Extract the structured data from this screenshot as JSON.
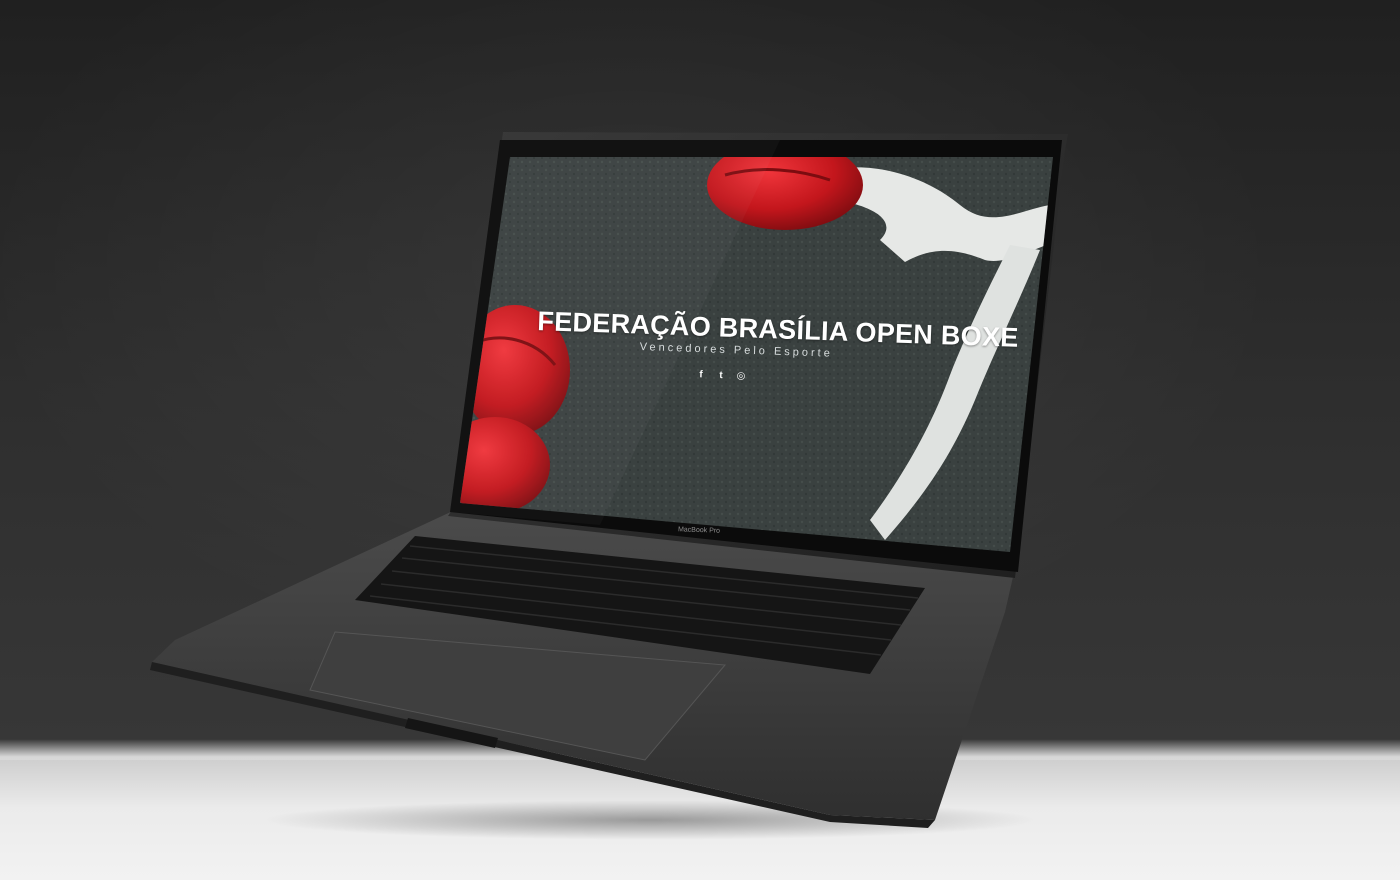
{
  "website": {
    "title": "FEDERAÇÃO BRASÍLIA OPEN BOXE",
    "tagline": "Vencedores Pelo Esporte",
    "social_icons": [
      {
        "icon": "facebook-icon",
        "glyph": "f"
      },
      {
        "icon": "twitter-icon",
        "glyph": "t"
      },
      {
        "icon": "instagram-icon",
        "glyph": "◎"
      }
    ]
  },
  "laptop": {
    "bezel_label": "MacBook Pro"
  },
  "colors": {
    "background": "#2b2b2b",
    "screen_mat": "#434b49",
    "glove_red": "#c3161c",
    "wrap_white": "#e6e8e6"
  }
}
